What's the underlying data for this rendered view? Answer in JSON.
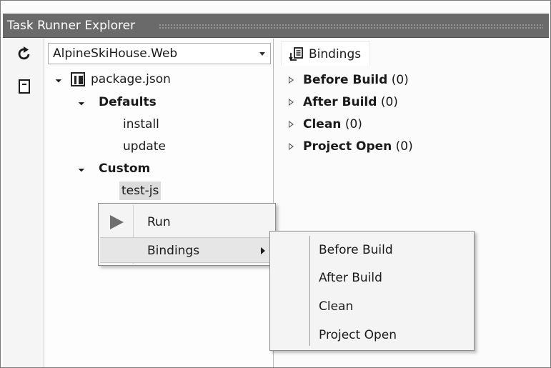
{
  "window": {
    "title": "Task Runner Explorer"
  },
  "toolbar": {
    "refresh_icon": "refresh-icon",
    "collapse_icon": "collapse-icon"
  },
  "project_selector": {
    "selected": "AlpineSkiHouse.Web"
  },
  "tree": {
    "root": {
      "label": "package.json",
      "icon": "package-json-icon",
      "expanded": true
    },
    "groups": [
      {
        "label": "Defaults",
        "expanded": true,
        "tasks": [
          "install",
          "update"
        ]
      },
      {
        "label": "Custom",
        "expanded": true,
        "tasks": [
          "test-js"
        ]
      }
    ],
    "selected_task": "test-js"
  },
  "bindings_panel": {
    "tab_label": "Bindings",
    "tab_icon": "bindings-icon",
    "items": [
      {
        "label": "Before Build",
        "count": "(0)"
      },
      {
        "label": "After Build",
        "count": "(0)"
      },
      {
        "label": "Clean",
        "count": "(0)"
      },
      {
        "label": "Project Open",
        "count": "(0)"
      }
    ]
  },
  "context_menu": {
    "items": [
      {
        "label": "Run",
        "icon": "run-icon"
      },
      {
        "label": "Bindings",
        "has_submenu": true,
        "highlighted": true
      }
    ]
  },
  "bindings_submenu": {
    "items": [
      "Before Build",
      "After Build",
      "Clean",
      "Project Open"
    ]
  },
  "colors": {
    "title_bar": "#6a6a6a",
    "title_text": "#ffffff",
    "selection": "#dcdcdc",
    "menu_background": "#f4f4f4",
    "menu_highlight": "#e6e6e6"
  }
}
